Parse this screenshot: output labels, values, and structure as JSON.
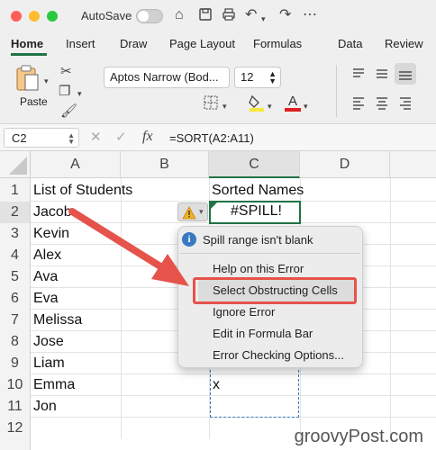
{
  "title_bar": {
    "autosave_label": "AutoSave"
  },
  "tabs": [
    "Home",
    "Insert",
    "Draw",
    "Page Layout",
    "Formulas",
    "Data",
    "Review"
  ],
  "ribbon": {
    "paste_label": "Paste",
    "font_name": "Aptos Narrow (Bod...",
    "font_size": "12"
  },
  "formula_bar": {
    "name_box": "C2",
    "fx": "fx",
    "formula": "=SORT(A2:A11)"
  },
  "columns": [
    "A",
    "B",
    "C",
    "D"
  ],
  "rows": [
    "1",
    "2",
    "3",
    "4",
    "5",
    "6",
    "7",
    "8",
    "9",
    "10",
    "11",
    "12"
  ],
  "col_a": [
    "List of Students",
    "Jacob",
    "Kevin",
    "Alex",
    "Ava",
    "Eva",
    "Melissa",
    "Jose",
    "Liam",
    "Emma",
    "Jon"
  ],
  "col_c": {
    "header": "Sorted Names",
    "spill_error": "#SPILL!",
    "obstruction": "x"
  },
  "error_menu": {
    "header": "Spill range isn't blank",
    "items": [
      "Help on this Error",
      "Select Obstructing Cells",
      "Ignore Error",
      "Edit in Formula Bar",
      "Error Checking Options..."
    ],
    "highlight_color": "#e5534b"
  },
  "accent_color": "#217346",
  "watermark": "groovyPost.com"
}
